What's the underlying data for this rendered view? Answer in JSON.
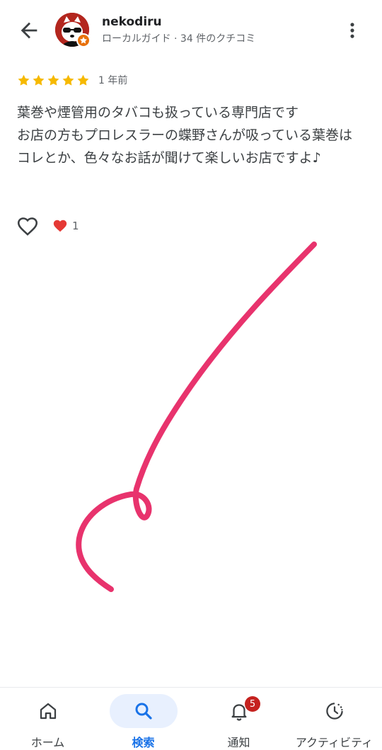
{
  "header": {
    "reviewer_name": "nekodiru",
    "reviewer_meta": "ローカルガイド · 34 件のクチコミ",
    "back_icon": "arrow-back-icon",
    "menu_icon": "more-vert-icon",
    "badge_icon": "local-guide-star-icon"
  },
  "review": {
    "rating": 5,
    "max_rating": 5,
    "time_ago": "1 年前",
    "text": "葉巻や煙管用のタバコも扱っている専門店です\nお店の方もプロレスラーの蝶野さんが吸っている葉巻はコレとか、色々なお話が聞けて楽しいお店ですよ♪",
    "like_icon": "heart-outline-icon",
    "reaction_icon": "red-heart-icon",
    "reaction_count": "1"
  },
  "colors": {
    "star": "#f6b900",
    "accent": "#1a73e8",
    "annotation_stroke": "#e8336d",
    "avatar_bg": "#b3261e",
    "notification_badge": "#c5221f"
  },
  "bottom_nav": {
    "items": [
      {
        "label": "ホーム",
        "icon": "home-icon",
        "active": false
      },
      {
        "label": "検索",
        "icon": "search-icon",
        "active": true
      },
      {
        "label": "通知",
        "icon": "bell-icon",
        "active": false,
        "badge": "5"
      },
      {
        "label": "アクティビティ",
        "icon": "activity-clock-icon",
        "active": false
      }
    ]
  }
}
